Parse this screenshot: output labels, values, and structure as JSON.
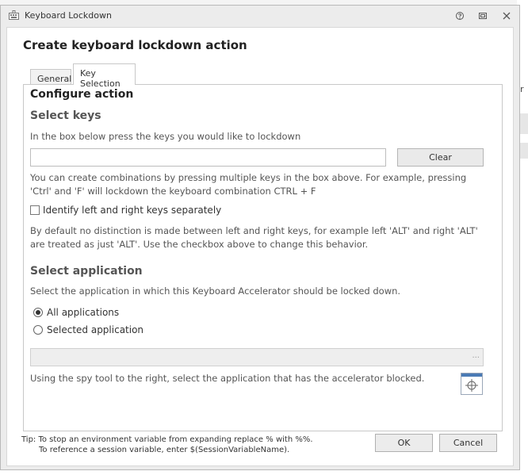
{
  "window": {
    "title": "Keyboard Lockdown",
    "heading": "Create keyboard lockdown action"
  },
  "tabs": [
    {
      "label": "General",
      "active": false
    },
    {
      "label": "Key Selection",
      "active": true
    }
  ],
  "configure": {
    "title": "Configure action",
    "select_keys_title": "Select keys",
    "select_keys_desc": "In the box below press the keys you would like to lockdown",
    "key_value": "",
    "clear_label": "Clear",
    "combination_help": "You can create combinations by pressing multiple keys in the box above. For example, pressing 'Ctrl' and 'F' will lockdown the keyboard combination CTRL + F",
    "identify_label": "Identify left and right keys separately",
    "identify_checked": false,
    "identify_help": "By default no distinction is made between left and right keys, for example left 'ALT' and right 'ALT' are treated as just 'ALT'. Use the checkbox above to change this behavior."
  },
  "application": {
    "title": "Select application",
    "desc": "Select the application in which this Keyboard Accelerator should be locked down.",
    "options": [
      {
        "label": "All applications",
        "selected": true
      },
      {
        "label": "Selected application",
        "selected": false
      }
    ],
    "app_value": "",
    "field_dots": "...",
    "spy_help": "Using the spy tool to the right, select the application that has the accelerator blocked."
  },
  "footer": {
    "tip_line1": "Tip: To stop an environment variable from expanding replace % with %%.",
    "tip_line2": "To reference a session variable, enter $(SessionVariableName).",
    "ok_label": "OK",
    "cancel_label": "Cancel"
  },
  "background": {
    "edge_glyph": "r"
  },
  "colors": {
    "accent": "#4a7ab5",
    "window_bg": "#ececec"
  }
}
